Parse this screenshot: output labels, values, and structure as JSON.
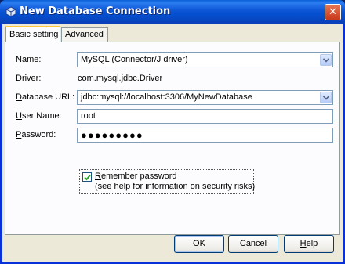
{
  "window": {
    "title": "New Database Connection",
    "close_glyph": "✕"
  },
  "tabs": [
    {
      "label": "Basic setting",
      "active": true
    },
    {
      "label": "Advanced",
      "active": false
    }
  ],
  "form": {
    "name": {
      "label_first": "N",
      "label_rest": "ame:",
      "value": "MySQL (Connector/J driver)"
    },
    "driver": {
      "label": "Driver:",
      "value": "com.mysql.jdbc.Driver"
    },
    "database_url": {
      "label_first": "D",
      "label_rest": "atabase URL:",
      "value": "jdbc:mysql://localhost:3306/MyNewDatabase"
    },
    "user_name": {
      "label_first": "U",
      "label_rest": "ser Name:",
      "value": "root"
    },
    "password": {
      "label_first": "P",
      "label_rest": "assword:",
      "value": "●●●●●●●●●"
    },
    "remember": {
      "checked": true,
      "label_first": "R",
      "label_rest": "emember password",
      "hint": "(see help for information on security risks)"
    }
  },
  "buttons": {
    "ok": "OK",
    "cancel": "Cancel",
    "help_first": "H",
    "help_rest": "elp"
  },
  "colors": {
    "title_bar": "#0a5fd8",
    "dialog_bg": "#ece9d8",
    "active_tab_accent": "#ffc83c"
  }
}
